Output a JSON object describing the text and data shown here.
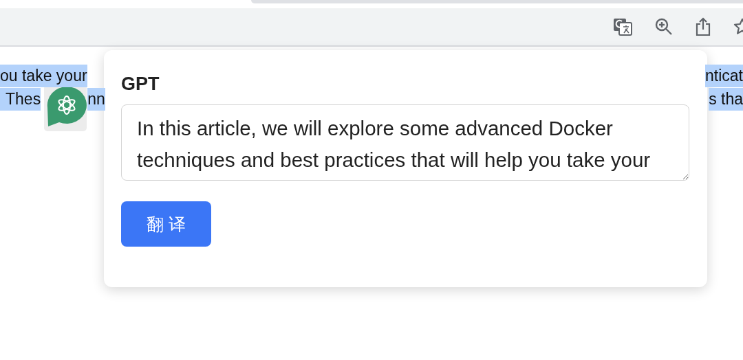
{
  "article": {
    "selected": true,
    "lines": [
      {
        "left": "ou take your",
        "right": "nticat"
      },
      {
        "left": "Thes",
        "left_after_icon": "nn",
        "right": "s tha"
      }
    ]
  },
  "popup": {
    "title": "GPT",
    "text_field": {
      "value": "In this article, we will explore some advanced Docker techniques and best practices that will help you take your"
    },
    "button": "翻 译"
  }
}
